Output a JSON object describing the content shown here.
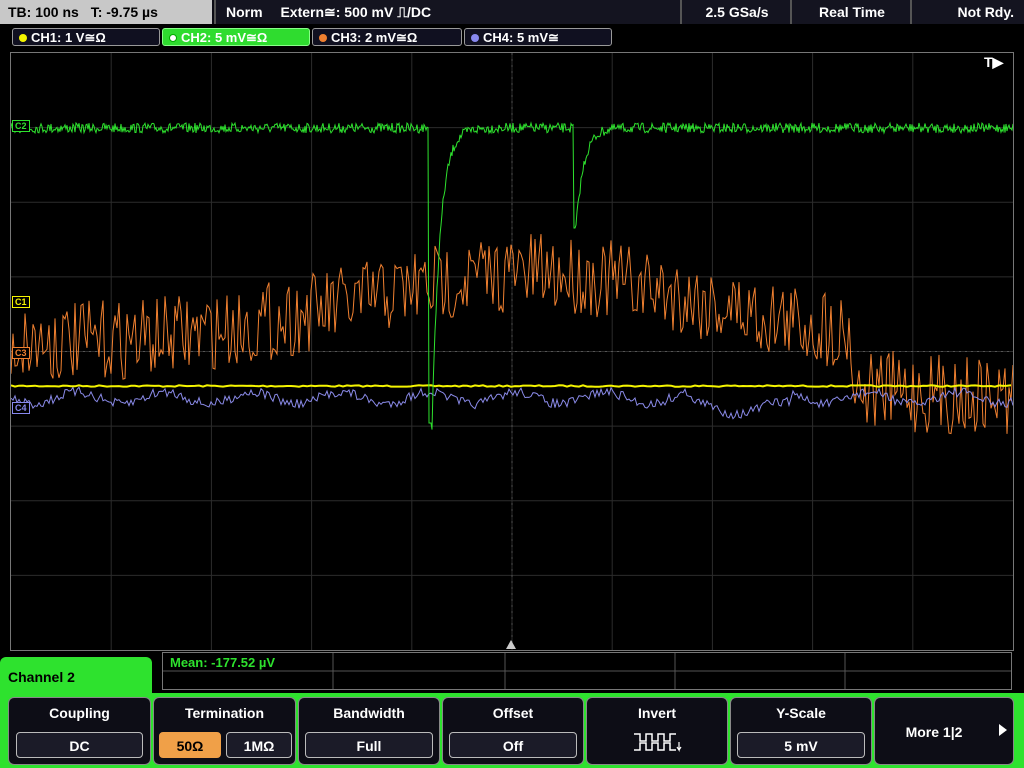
{
  "status": {
    "timebase": "TB: 100 ns",
    "trigger_time": "T: -9.75 µs",
    "mode": "Norm",
    "trigger": "Extern≅: 500 mV ⎍/DC",
    "sample_rate": "2.5 GSa/s",
    "acq_mode": "Real Time",
    "state": "Not Rdy."
  },
  "channels": [
    {
      "label": "CH1: 1 V≅Ω",
      "color": "#f5f500"
    },
    {
      "label": "CH2: 5 mV≅Ω",
      "color": "#2ee22e"
    },
    {
      "label": "CH3: 2 mV≅Ω",
      "color": "#f08030"
    },
    {
      "label": "CH4: 5 mV≅",
      "color": "#8888ee"
    }
  ],
  "markers": {
    "c1": "C1",
    "c2": "C2",
    "c3": "C3",
    "c4": "C4",
    "trigger": "T▶"
  },
  "menu": {
    "title": "Channel 2",
    "measurement": "Mean: -177.52 µV",
    "softkeys": {
      "coupling": {
        "title": "Coupling",
        "value": "DC"
      },
      "termination": {
        "title": "Termination",
        "opt1": "50Ω",
        "opt2": "1MΩ",
        "selected": "50Ω"
      },
      "bandwidth": {
        "title": "Bandwidth",
        "value": "Full"
      },
      "offset": {
        "title": "Offset",
        "value": "Off"
      },
      "invert": {
        "title": "Invert"
      },
      "yscale": {
        "title": "Y-Scale",
        "value": "5 mV"
      },
      "more": {
        "label": "More 1|2"
      }
    }
  }
}
